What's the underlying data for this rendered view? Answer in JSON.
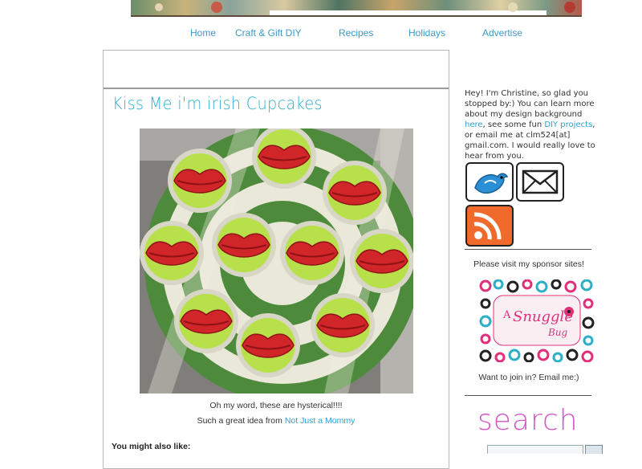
{
  "nav": {
    "home": "Home",
    "craft": "Craft & Gift DIY",
    "recipes": "Recipes",
    "holidays": "Holidays",
    "advertise": "Advertise"
  },
  "post": {
    "title": "Kiss Me i'm irish Cupcakes",
    "caption_1": "Oh my word, these are hysterical!!!!",
    "caption_2_prefix": "Such a great idea from ",
    "caption_2_link": "Not Just a Mommy",
    "also_like": "You might also like:"
  },
  "sidebar": {
    "bio": {
      "p1": "Hey! I'm Christine, so glad you stopped by:) You can learn more about my design background ",
      "link_here": "here",
      "p2": ", see some fun ",
      "link_diy": "DIY projects",
      "p3": ", or email me at clm524[at] gmail.com. I would really love to hear from you."
    },
    "sponsor_prompt": "Please visit my sponsor sites!",
    "sponsor_logo_a": "A",
    "sponsor_logo_snuggle": "Snuggle",
    "sponsor_logo_bug": "Bug",
    "join": "Want to join in? Email me:)",
    "search_heading": "search"
  },
  "icons": {
    "twitter": "twitter-bird-icon",
    "email": "envelope-icon",
    "rss": "rss-feed-icon"
  },
  "colors": {
    "link": "#2e9fd0",
    "title": "#2eaed1",
    "search": "#d357c4",
    "rss": "#ef6a2b",
    "twitter": "#2b8fd6"
  }
}
